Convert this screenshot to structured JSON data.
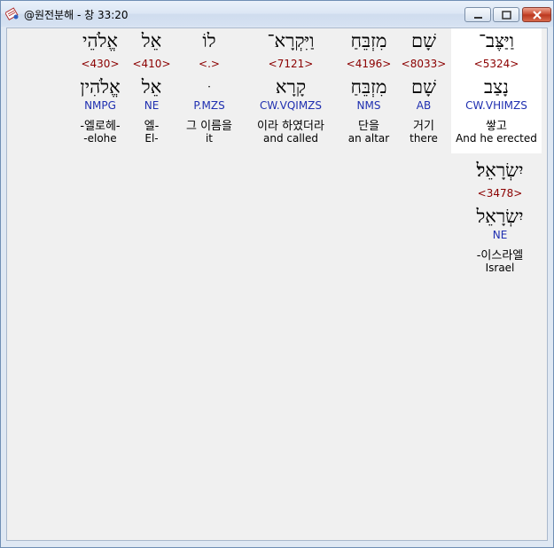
{
  "window": {
    "title": "@원전분해 - 창 33:20"
  },
  "words": [
    {
      "heb": "וַיַּצֶּב־",
      "strong": "<5324>",
      "lemma": "נָצַב",
      "parse": "CW.VHIMZS",
      "kor": "쌓고",
      "eng": "And he erected"
    },
    {
      "heb": "שָׁם",
      "strong": "<8033>",
      "lemma": "שָׁם",
      "parse": "AB",
      "kor": "거기",
      "eng": "there"
    },
    {
      "heb": "מִזְבֵּחַ",
      "strong": "<4196>",
      "lemma": "מִזְבֵּחַ",
      "parse": "NMS",
      "kor": "단을",
      "eng": "an altar"
    },
    {
      "heb": "וַיִּקְרָא־",
      "strong": "<7121>",
      "lemma": "קָרָא",
      "parse": "CW.VQIMZS",
      "kor": "이라 하였더라",
      "eng": "and called"
    },
    {
      "heb": "לוֹ",
      "strong": "<.>",
      "lemma": "ּ",
      "parse": "P.MZS",
      "kor": "그 이름을",
      "eng": "it"
    },
    {
      "heb": "אֵל",
      "strong": "<410>",
      "lemma": "אֵל",
      "parse": "NE",
      "kor": "엘-",
      "eng": "El-"
    },
    {
      "heb": "אֱלֹהֵי",
      "strong": "<430>",
      "lemma": "אֱלֹהִין",
      "parse": "NMPG",
      "kor": "-엘로헤-",
      "eng": "-elohe"
    },
    {
      "heb": "יִשְׂרָאֵל׃",
      "strong": "<3478>",
      "lemma": "יִשְׂרָאֵל",
      "parse": "NE",
      "kor": "-이스라엘",
      "eng": "Israel"
    }
  ]
}
